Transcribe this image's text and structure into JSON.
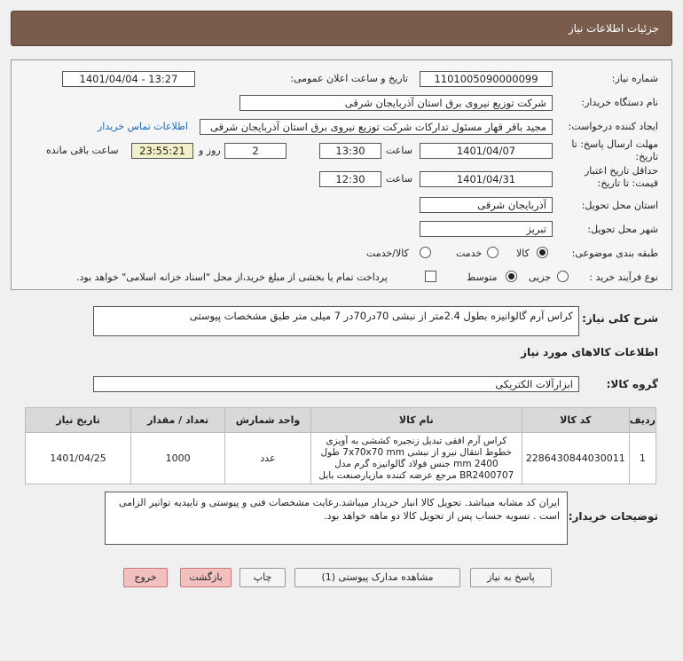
{
  "title": "جزئیات اطلاعات نیاز",
  "form": {
    "need_number_label": "شماره نیاز:",
    "need_number": "1101005090000099",
    "announce_label": "تاریخ و ساعت اعلان عمومی:",
    "announce_value": "1401/04/04 - 13:27",
    "buyer_label": "نام دستگاه خریدار:",
    "buyer": "شرکت توزیع نیروی برق استان آذربایجان شرقی",
    "creator_label": "ایجاد کننده درخواست:",
    "creator": "مجید باقر قهار مسئول تدارکات شرکت توزیع نیروی برق استان آذربایجان شرقی",
    "contact_link": "اطلاعات تماس خریدار",
    "reply_deadline_label_1": "مهلت ارسال پاسخ: تا",
    "reply_deadline_label_2": "تاریخ:",
    "reply_date": "1401/04/07",
    "time_label": "ساعت",
    "reply_time": "13:30",
    "days_value": "2",
    "days_label": "روز و",
    "remaining_time": "23:55:21",
    "remaining_label": "ساعت باقی مانده",
    "validity_label_1": "حداقل تاریخ اعتبار",
    "validity_label_2": "قیمت: تا تاریخ:",
    "validity_date": "1401/04/31",
    "validity_time": "12:30",
    "province_label": "استان محل تحویل:",
    "province": "آذربایجان شرقی",
    "city_label": "شهر محل تحویل:",
    "city": "تبریز",
    "category_label": "طبقه بندی موضوعی:",
    "category_options": [
      "کالا",
      "خدمت",
      "کالا/خدمت"
    ],
    "purchase_type_label": "نوع فرآیند خرید :",
    "purchase_options": [
      "جزیی",
      "متوسط"
    ],
    "payment_note": "پرداخت تمام یا بخشی از مبلغ خرید،از محل \"اسناد خزانه اسلامی\" خواهد بود."
  },
  "summary": {
    "label": "شرح کلی نیاز:",
    "text": "کراس آرم گالوانیزه بطول 2.4متر از نبشی 70در70در 7 میلی متر طبق مشخصات پیوستی"
  },
  "goods_info_title": "اطلاعات کالاهای مورد نیاز",
  "goods_group": {
    "label": "گروه کالا:",
    "value": "ابزارآلات الکتریکی"
  },
  "table": {
    "headers": [
      "ردیف",
      "کد کالا",
      "نام کالا",
      "واحد شمارش",
      "تعداد / مقدار",
      "تاریخ نیاز"
    ],
    "rows": [
      {
        "row": "1",
        "code": "2286430844030011",
        "name": "کراس آرم افقی تبدیل زنجیره کششی به آویزی خطوط انتقال نیرو از نبشی 7x70x70 mm طول 2400 mm جنس فولاد گالوانیزه گرم مدل BR2400707 مرجع عرضه کننده مازیارصنعت بابل",
        "unit": "عدد",
        "qty": "1000",
        "date": "1401/04/25"
      }
    ]
  },
  "buyer_notes": {
    "label": "توضیحات خریدار:",
    "text": "ایران کد مشابه میباشد. تحویل کالا انبار خریدار میباشد.رعایت مشخصات فنی و پیوستی و تاییدیه توانیر الزامی است . تسویه حساب پس از تحویل کالا دو ماهه خواهد بود."
  },
  "buttons": {
    "reply": "پاسخ به نیاز",
    "attachments": "مشاهده مدارک پیوستی (1)",
    "print": "چاپ",
    "back": "بازگشت",
    "exit": "خروج"
  }
}
